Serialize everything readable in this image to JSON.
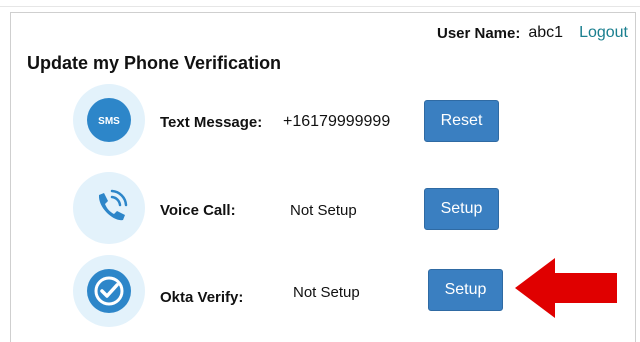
{
  "header": {
    "user_label": "User Name:",
    "user_value": "abc1",
    "logout_label": "Logout"
  },
  "title": "Update my Phone Verification",
  "methods": [
    {
      "label": "Text Message:",
      "value": "+16179999999",
      "button": "Reset",
      "icon": "sms-icon",
      "icon_text": "SMS"
    },
    {
      "label": "Voice Call:",
      "value": "Not Setup",
      "button": "Setup",
      "icon": "phone-call-icon"
    },
    {
      "label": "Okta Verify:",
      "value": "Not Setup",
      "button": "Setup",
      "icon": "checkmark-icon"
    }
  ],
  "colors": {
    "accent": "#3a7fc1",
    "icon_bg": "#e3f2fb",
    "icon_fg": "#2d86c9",
    "link": "#1a7f8f",
    "arrow": "#e00000"
  }
}
